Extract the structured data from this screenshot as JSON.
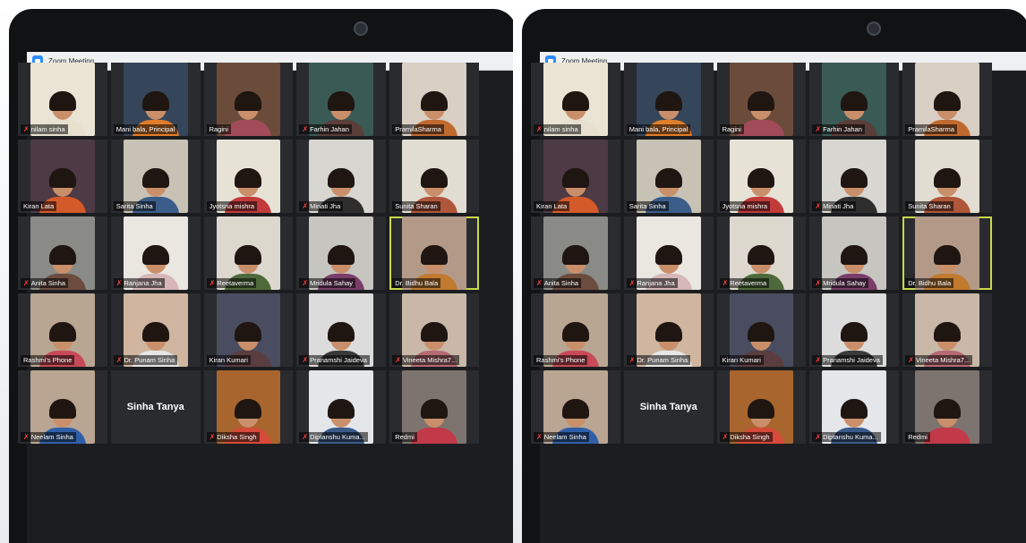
{
  "window_title": "Zoom Meeting",
  "icons": {
    "app": "zoom-logo-icon",
    "muted": "mic-muted-icon"
  },
  "accent_colors": {
    "zoom_blue": "#2d8cff",
    "active_speaker": "#c8d84a",
    "muted": "#ff3b3b"
  },
  "participants": [
    {
      "name": "nilam sinha",
      "muted": true,
      "bg": "#e9e4d4",
      "cloth": "#e7e0cf"
    },
    {
      "name": "Mani bala, Principal",
      "muted": false,
      "bg": "#36465a",
      "cloth": "#e07d2a"
    },
    {
      "name": "Ragini",
      "muted": false,
      "bg": "#6b4c3a",
      "cloth": "#a14b58"
    },
    {
      "name": "Farhin Jahan",
      "muted": true,
      "bg": "#3a5a55",
      "cloth": "#5a3e3a"
    },
    {
      "name": "PramilaSharma",
      "muted": false,
      "bg": "#d9cfc4",
      "cloth": "#c0692f"
    },
    {
      "name": "Kiran Lata",
      "muted": false,
      "bg": "#4d3a44",
      "cloth": "#d45a2a"
    },
    {
      "name": "Sarita Sinha",
      "muted": false,
      "bg": "#c8c2b4",
      "cloth": "#3b5d8a"
    },
    {
      "name": "Jyotsna mishra",
      "muted": false,
      "bg": "#e6e2d6",
      "cloth": "#c23a3a"
    },
    {
      "name": "Minati Jha",
      "muted": true,
      "bg": "#d8d6d0",
      "cloth": "#2e2e2e"
    },
    {
      "name": "Sunita Sharan",
      "muted": false,
      "bg": "#e2ddd2",
      "cloth": "#b0563a"
    },
    {
      "name": "Anita Sinha",
      "muted": true,
      "bg": "#8a8a86",
      "cloth": "#6b4c3e"
    },
    {
      "name": "Ranjana Jha",
      "muted": true,
      "bg": "#eae6e0",
      "cloth": "#d6b6b8"
    },
    {
      "name": "Reetaverma",
      "muted": true,
      "bg": "#ddd8ce",
      "cloth": "#4f6a3a"
    },
    {
      "name": "Mridula Sahay",
      "muted": true,
      "bg": "#c7c5c0",
      "cloth": "#7a3d6a"
    },
    {
      "name": "Dr. Bidhu Bala",
      "muted": false,
      "bg": "#b39a88",
      "cloth": "#c27a2f",
      "active": true
    },
    {
      "name": "Rashmi's Phone",
      "muted": false,
      "bg": "#b8a592",
      "cloth": "#c84a58"
    },
    {
      "name": "Dr. Punam Sinha",
      "muted": true,
      "bg": "#d0b6a0",
      "cloth": "#e6e6e6"
    },
    {
      "name": "Kiran Kumari",
      "muted": false,
      "bg": "#4a4d60",
      "cloth": "#5a3d40"
    },
    {
      "name": "Pranamshi Jaideva",
      "muted": true,
      "bg": "#dcdcdc",
      "cloth": "#3a3a3a"
    },
    {
      "name": "Vineeta Mishra7...",
      "muted": true,
      "bg": "#c9b8a8",
      "cloth": "#b56a74"
    },
    {
      "name": "Neelam Sinha",
      "muted": true,
      "bg": "#b9a592",
      "cloth": "#2f5fa8"
    },
    {
      "name": "Sinha Tanya",
      "muted": false,
      "no_video": true
    },
    {
      "name": "Diksha Singh",
      "muted": true,
      "bg": "#a8652e",
      "cloth": "#d64a3a"
    },
    {
      "name": "Diptanshu Kuma...",
      "muted": true,
      "bg": "#e4e6ea",
      "cloth": "#3a5a8a"
    },
    {
      "name": "Redmi",
      "muted": false,
      "bg": "#7d7470",
      "cloth": "#c23a4a"
    }
  ]
}
